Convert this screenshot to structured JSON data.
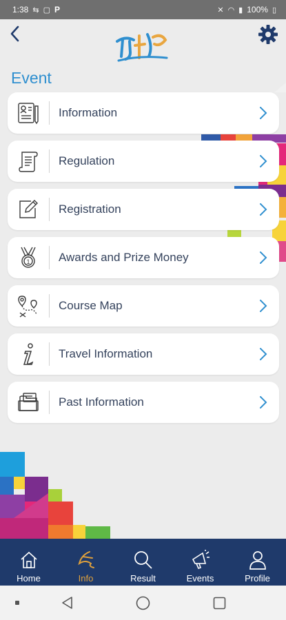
{
  "status_bar": {
    "time": "1:38",
    "app_letter": "P",
    "battery": "100%"
  },
  "header": {
    "back_icon": "chevron-left-icon",
    "settings_icon": "gear-icon",
    "accent_color": "#2f8fcf"
  },
  "section": {
    "title": "Event"
  },
  "menu": {
    "items": [
      {
        "label": "Information",
        "icon": "id-document-icon"
      },
      {
        "label": "Regulation",
        "icon": "scroll-icon"
      },
      {
        "label": "Registration",
        "icon": "edit-form-icon"
      },
      {
        "label": "Awards and Prize Money",
        "icon": "medal-icon"
      },
      {
        "label": "Course Map",
        "icon": "map-route-icon"
      },
      {
        "label": "Travel Information",
        "icon": "info-icon"
      },
      {
        "label": "Past Information",
        "icon": "folder-archive-icon"
      }
    ]
  },
  "bottom_nav": {
    "items": [
      {
        "label": "Home",
        "icon": "home-icon",
        "active": false
      },
      {
        "label": "Info",
        "icon": "info-logo-icon",
        "active": true
      },
      {
        "label": "Result",
        "icon": "search-icon",
        "active": false
      },
      {
        "label": "Events",
        "icon": "megaphone-icon",
        "active": false
      },
      {
        "label": "Profile",
        "icon": "person-icon",
        "active": false
      }
    ],
    "background": "#1f3a6b",
    "active_color": "#e0a13c"
  }
}
